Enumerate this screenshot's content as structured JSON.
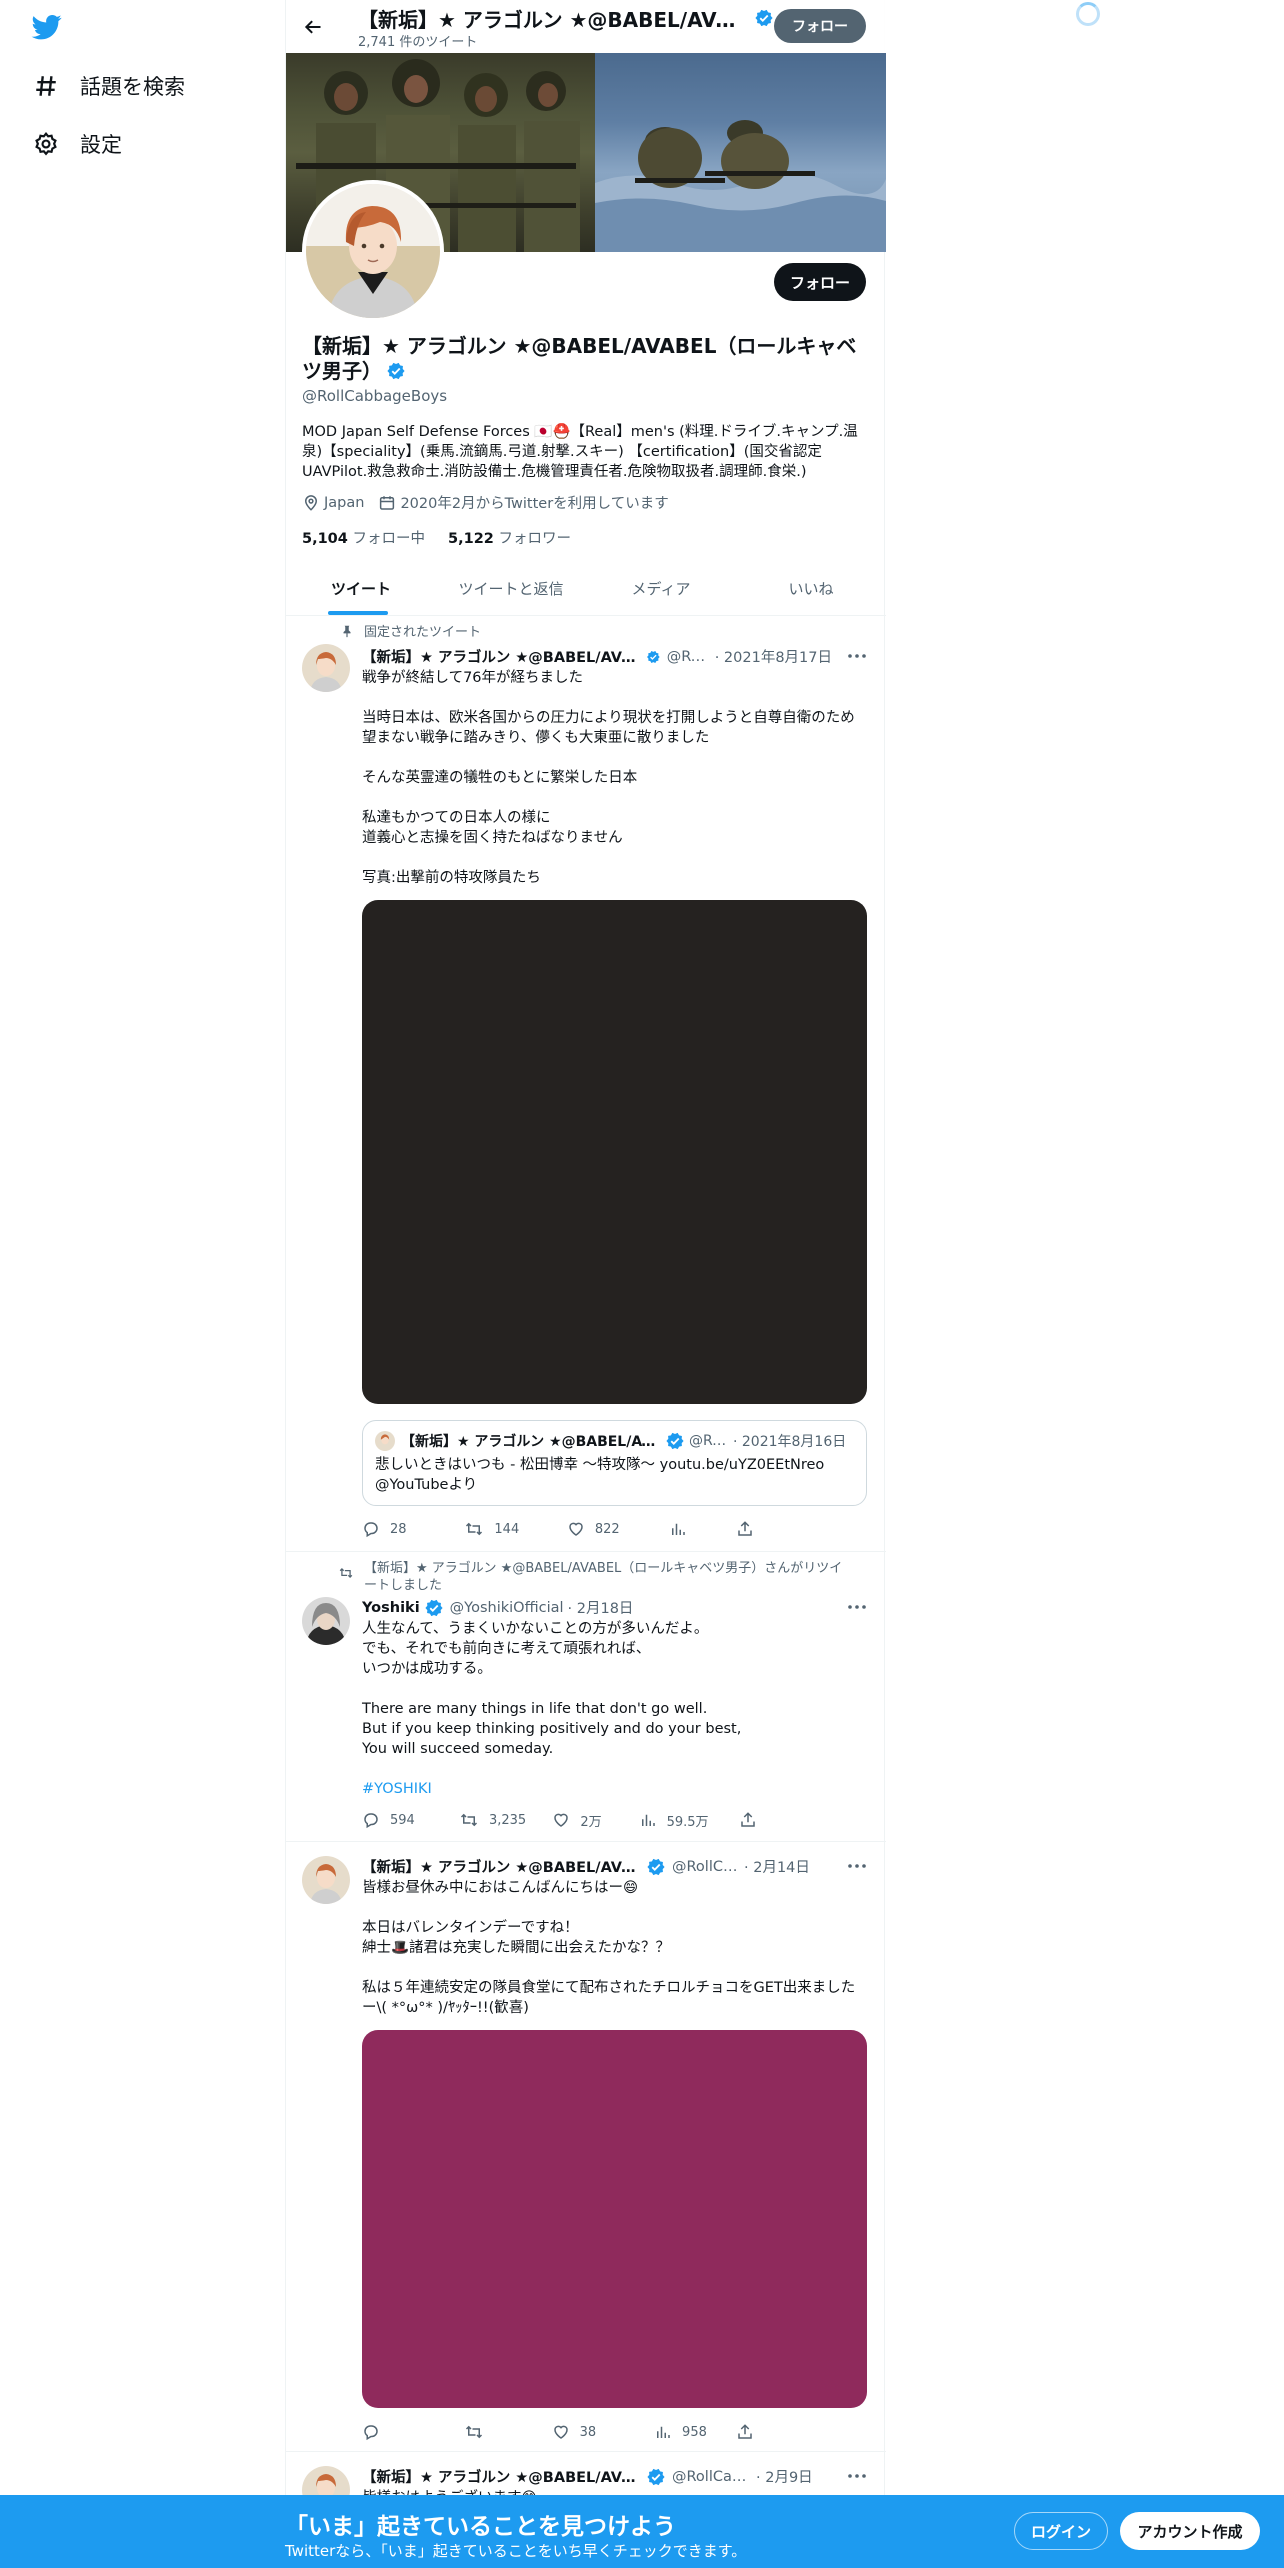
{
  "nav": {
    "explore_label": "話題を検索",
    "settings_label": "設定"
  },
  "header": {
    "name": "【新垢】★ アラゴルン ★@BABEL/AVABEL（ロールキャベツ男子）",
    "tweet_count": "2,741 件のツイート",
    "follow_label": "フォロー"
  },
  "profile": {
    "name": "【新垢】★ アラゴルン ★@BABEL/AVABEL（ロールキャベツ男子）",
    "handle": "@RollCabbageBoys",
    "bio": "MOD Japan Self Defense Forces 🇯🇵⛑️【Real】men's (料理.ドライブ.キャンプ.温泉)【speciality】(乗馬.流鏑馬.弓道.射撃.スキー) 【certification】(国交省認定UAVPilot.救急救命士.消防設備士.危機管理責任者.危険物取扱者.調理師.食栄.)",
    "location": "Japan",
    "joined": "2020年2月からTwitterを利用しています",
    "following_count": "5,104",
    "following_label": "フォロー中",
    "followers_count": "5,122",
    "followers_label": "フォロワー",
    "follow_label": "フォロー"
  },
  "tabs": [
    {
      "label": "ツイート",
      "active": true
    },
    {
      "label": "ツイートと返信",
      "active": false
    },
    {
      "label": "メディア",
      "active": false
    },
    {
      "label": "いいね",
      "active": false
    }
  ],
  "tweets": [
    {
      "social": "固定されたツイート",
      "name": "【新垢】★ アラゴルン ★@BABEL/AVABEL（ロールキャベツ男子）",
      "handle": "@RollCabbageBoys",
      "date": "· 2021年8月17日",
      "lines": [
        "戦争が終結して76年が経ちました",
        "",
        "当時日本は、欧米各国からの圧力により現状を打開しようと自尊自衛のため望まない戦争に踏みきり、儚くも大東亜に散りました",
        "",
        "そんな英霊達の犠牲のもとに繁栄した日本",
        "",
        "私達もかつての日本人の様に",
        "道義心と志操を固く持たねばなりません",
        "",
        "写真:出撃前の特攻隊員たち"
      ],
      "media_color": "#252220",
      "quote": {
        "name": "【新垢】★ アラゴルン ★@BABEL/AVABEL（ロールキャベツ男子）",
        "handle": "@RollCabbageBoys",
        "date": "· 2021年8月16日",
        "text": "悲しいときはいつも - 松田博幸 ～特攻隊～ youtu.be/uYZ0EEtNreo @YouTubeより"
      },
      "replies": "28",
      "retweets": "144",
      "likes": "822",
      "views": ""
    },
    {
      "social": "【新垢】★ アラゴルン ★@BABEL/AVABEL（ロールキャベツ男子）さんがリツイートしました",
      "name": "Yoshiki",
      "handle": "@YoshikiOfficial",
      "date": "· 2月18日",
      "lines": [
        "人生なんて、うまくいかないことの方が多いんだよ。",
        "でも、それでも前向きに考えて頑張れれば、",
        "いつかは成功する。",
        "",
        "There are many things in life that don't go well.",
        "But if you keep thinking positively and do your best,",
        "You will succeed someday.",
        ""
      ],
      "hashtag": "#YOSHIKI",
      "replies": "594",
      "retweets": "3,235",
      "likes": "2万",
      "views": "59.5万"
    },
    {
      "name": "【新垢】★ アラゴルン ★@BABEL/AVABEL（ロールキャベツ男子）",
      "handle": "@RollCabbageBoys",
      "date": "· 2月14日",
      "lines": [
        "皆様お昼休み中におはこんばんにちはー😄",
        "",
        "本日はバレンタインデーですね！",
        "紳士🎩諸君は充実した瞬間に出会えたかな？？",
        "",
        "私は５年連続安定の隊員食堂にて配布されたチロルチョコをGET出来ましたー\\( *°ω°* )/ﾔｯﾀｰ!!(歓喜)"
      ],
      "media_color": "#8f2a5c",
      "replies": "",
      "retweets": "",
      "likes": "38",
      "views": "958"
    },
    {
      "name": "【新垢】★ アラゴルン ★@BABEL/AVABEL（ロールキャベツ男子）",
      "handle": "@RollCabbageBoys",
      "date": "· 2月9日",
      "text": "皆様おはようございます😊"
    }
  ],
  "bottom": {
    "title": "「いま」起きていることを見つけよう",
    "subtitle": "Twitterなら、「いま」起きていることをいち早くチェックできます。",
    "login": "ログイン",
    "signup": "アカウント作成"
  },
  "colors": {
    "accent": "#1d9bf0",
    "text": "#0f1419",
    "secondary": "#536471"
  }
}
